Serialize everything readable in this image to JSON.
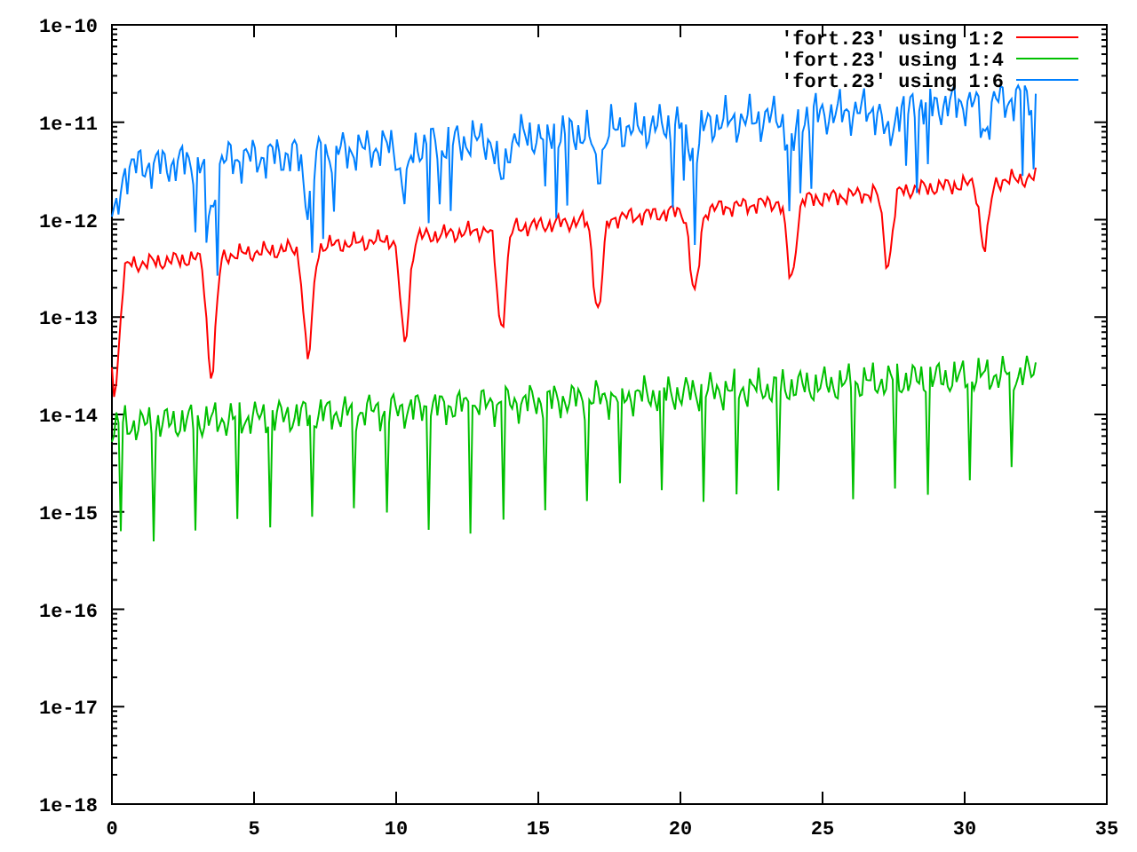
{
  "plot": {
    "x_tick_labels": [
      "0",
      "5",
      "10",
      "15",
      "20",
      "25",
      "30",
      "35"
    ],
    "y_tick_labels": [
      "1e-10",
      "1e-11",
      "1e-12",
      "1e-13",
      "1e-14",
      "1e-15",
      "1e-16",
      "1e-17",
      "1e-18"
    ],
    "legend": [
      {
        "label": "'fort.23' using 1:2",
        "color": "#ff0000"
      },
      {
        "label": "'fort.23' using 1:4",
        "color": "#00c000"
      },
      {
        "label": "'fort.23' using 1:6",
        "color": "#0080ff"
      }
    ]
  }
}
